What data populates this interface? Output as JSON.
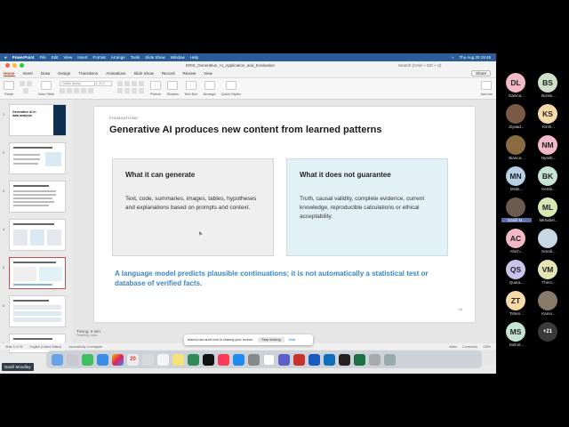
{
  "os_menubar": {
    "app": "PowerPoint",
    "items": [
      "File",
      "Edit",
      "View",
      "Insert",
      "Format",
      "Arrange",
      "Tools",
      "Slide Show",
      "Window",
      "Help"
    ],
    "clock": "Thu Aug 20 19:46"
  },
  "window": {
    "doc_title": "ERIS_Generative_AI_Application_and_Evaluation",
    "search_placeholder": "Search (Cmd + Ctrl + U)"
  },
  "ribbon": {
    "tabs": [
      "Home",
      "Insert",
      "Draw",
      "Design",
      "Transitions",
      "Animations",
      "Slide Show",
      "Record",
      "Review",
      "View"
    ],
    "active_tab": "Home",
    "share_label": "Share",
    "font_name": "Calibri (Body)",
    "font_size": "20.0",
    "paste_label": "Paste",
    "new_slide_label": "New Slide",
    "picture_label": "Picture",
    "shapes_label": "Shapes",
    "text_box_label": "Text Box",
    "arrange_label": "Arrange",
    "quick_styles_label": "Quick Styles",
    "add_ins_label": "Add-ins"
  },
  "slide": {
    "section": "FOUNDATIONS",
    "title": "Generative AI produces new content from learned patterns",
    "left_card": {
      "heading": "What it can generate",
      "body": "Text, code, summaries, images, tables, hypotheses and explanations based on prompts and context."
    },
    "right_card": {
      "heading": "What it does not guarantee",
      "body": "Truth, causal validity, complete evidence, current knowledge, reproducible calculations or ethical acceptability."
    },
    "bottom_note": "A language model predicts plausible continuations; it is not automatically a statistical test or database of verified facts.",
    "page_number": "05"
  },
  "thumbnails": {
    "numbers": [
      "1",
      "2",
      "3",
      "4",
      "5",
      "6",
      "7"
    ],
    "first_title": "Generative AI in data analysis",
    "selected_index": 5
  },
  "notes": {
    "title": "Timing: 5 min",
    "sub": "Teaching notes"
  },
  "statusbar": {
    "slide_of": "Slide 5 of 25",
    "language": "English (United States)",
    "accessibility": "Accessibility: Investigate",
    "notes_btn": "Notes",
    "comments_btn": "Comments",
    "zoom": "138%"
  },
  "screen_share": {
    "message": "teams.microsoft.com is sharing your screen.",
    "stop_label": "Stop sharing",
    "hide_label": "Hide"
  },
  "dock": {
    "calendar_day": "20"
  },
  "presenter_name": "Danill Moodley",
  "participants": [
    {
      "initials": "DL",
      "name": "Danica...",
      "color": "#f2b8c6"
    },
    {
      "initials": "BS",
      "name": "Bonisi...",
      "color": "#cfe0c8"
    },
    {
      "initials": "",
      "name": "Ziyaad...",
      "color": "#7a5a45"
    },
    {
      "initials": "KS",
      "name": "Kirsh...",
      "color": "#f5d9a6"
    },
    {
      "initials": "",
      "name": "Bianca...",
      "color": "#8a6a40"
    },
    {
      "initials": "NM",
      "name": "Nyash...",
      "color": "#f0b8c8"
    },
    {
      "initials": "MN",
      "name": "Msibi...",
      "color": "#b8cfe8"
    },
    {
      "initials": "BK",
      "name": "Kemb...",
      "color": "#c5e3d3"
    },
    {
      "initials": "",
      "name": "Danill M...",
      "color": "#6b5a50"
    },
    {
      "initials": "ML",
      "name": "Mkhabel...",
      "color": "#d4e7b5"
    },
    {
      "initials": "AC",
      "name": "Ahich...",
      "color": "#f2b8c6"
    },
    {
      "initials": "",
      "name": "Nondi...",
      "color": "#c9d6e3"
    },
    {
      "initials": "QS",
      "name": "Quara...",
      "color": "#c9c4ec"
    },
    {
      "initials": "VM",
      "name": "Them...",
      "color": "#e6e3b5"
    },
    {
      "initials": "ZT",
      "name": "Tshen...",
      "color": "#f5d9a6"
    },
    {
      "initials": "",
      "name": "Kamo...",
      "color": "#8a7a6a"
    },
    {
      "initials": "MS",
      "name": "Mohol...",
      "color": "#c5e3d3"
    },
    {
      "initials": "+21",
      "name": "",
      "color": "#3a3a3a"
    }
  ]
}
